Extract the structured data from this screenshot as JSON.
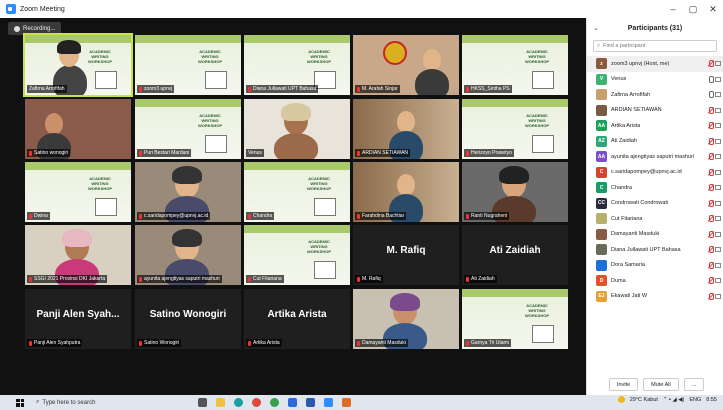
{
  "window": {
    "title": "Zoom Meeting",
    "controls": [
      "–",
      "▢",
      "✕"
    ]
  },
  "recording_label": "Recording...",
  "slide_text": [
    "ACADEMIC",
    "WRITING",
    "WORKSHOP"
  ],
  "tiles": [
    {
      "name": "Zafirna Arrofifah",
      "muted": false,
      "active": true
    },
    {
      "name": "zoom3 upnvj",
      "muted": true
    },
    {
      "name": "Diana Jullawati UPT Bahasa",
      "muted": true
    },
    {
      "name": "M. Arafah Sinjar",
      "muted": true
    },
    {
      "name": "HKSS_Sintha PS",
      "muted": true
    },
    {
      "name": "Satino wonogiri",
      "muted": true
    },
    {
      "name": "Puri Bestari Mardani",
      "muted": true
    },
    {
      "name": "Venus",
      "muted": false
    },
    {
      "name": "ARDIAN SETIAWAN",
      "muted": true
    },
    {
      "name": "Herizoyo Prasetyo",
      "muted": true
    },
    {
      "name": "Dwina",
      "muted": true
    },
    {
      "name": "c.saridapompey@upnvj.ac.id",
      "muted": true
    },
    {
      "name": "Chandra",
      "muted": true
    },
    {
      "name": "Farahdina Bachtiar",
      "muted": true
    },
    {
      "name": "Ranti Nugraheni",
      "muted": true
    },
    {
      "name": "SSGI 2021 Provinsi DKI Jakarta",
      "muted": true
    },
    {
      "name": "ayunita ajengtiyas saputri mashuri",
      "muted": true
    },
    {
      "name": "Cut Fitariana",
      "muted": true
    },
    {
      "name": "M. Rafiq",
      "muted": true,
      "big": "M. Rafiq"
    },
    {
      "name": "Ati Zaidiah",
      "muted": true,
      "big": "Ati Zaidiah"
    },
    {
      "name": "Panji Alen Syahputra",
      "muted": true,
      "big": "Panji Alen Syah..."
    },
    {
      "name": "Satino Wonogiri",
      "muted": true,
      "big": "Satino Wonogiri"
    },
    {
      "name": "Artika Arista",
      "muted": true,
      "big": "Artika Arista"
    },
    {
      "name": "Damayanti Masduki",
      "muted": true
    },
    {
      "name": "Garnya Tri Utami",
      "muted": true
    }
  ],
  "panel": {
    "title": "Participants (31)",
    "search_placeholder": "Find a participant",
    "participants": [
      {
        "name": "zoom3 upnvj (Host, me)",
        "initials": "z",
        "color": "#8b5a3c",
        "mic": "muted"
      },
      {
        "name": "Venus",
        "initials": "V",
        "color": "#3cb371",
        "mic": "on"
      },
      {
        "name": "Zafirna Arrofifah",
        "initials": "",
        "color": "#c9a06a",
        "mic": "on"
      },
      {
        "name": "ARDIAN SETIAWAN",
        "initials": "",
        "color": "#7a5a40",
        "mic": "muted"
      },
      {
        "name": "Artika Arista",
        "initials": "AA",
        "color": "#1aa05a",
        "mic": "muted"
      },
      {
        "name": "Ati Zaidiah",
        "initials": "AZ",
        "color": "#2aa87a",
        "mic": "muted"
      },
      {
        "name": "ayunita ajengtiyas saputri mashuri",
        "initials": "AA",
        "color": "#7b4fc9",
        "mic": "muted"
      },
      {
        "name": "c.saridapompey@upnvj.ac.id",
        "initials": "C",
        "color": "#d9412f",
        "mic": "muted"
      },
      {
        "name": "Chandra",
        "initials": "C",
        "color": "#1a9a6a",
        "mic": "muted"
      },
      {
        "name": "Condrowati Condrowati",
        "initials": "CC",
        "color": "#2a2a3a",
        "mic": "muted"
      },
      {
        "name": "Cut Fitariana",
        "initials": "",
        "color": "#b8b06a",
        "mic": "muted"
      },
      {
        "name": "Damayanti Masduki",
        "initials": "",
        "color": "#8a5a44",
        "mic": "muted"
      },
      {
        "name": "Diana Jullawati UPT Bahasa",
        "initials": "",
        "color": "#6a6a5a",
        "mic": "muted"
      },
      {
        "name": "Dora Samaria",
        "initials": "",
        "color": "#1e6fd9",
        "mic": "muted"
      },
      {
        "name": "Duma",
        "initials": "D",
        "color": "#e0532a",
        "mic": "muted"
      },
      {
        "name": "Ekawati Jati W",
        "initials": "EJ",
        "color": "#e8a030",
        "mic": "muted"
      }
    ],
    "invite_label": "Invite",
    "mute_all_label": "Mute All",
    "more_label": "..."
  },
  "taskbar": {
    "search_placeholder": "Type here to search",
    "weather": "29°C Kabut",
    "lang": "ENG",
    "time": "8:55"
  }
}
